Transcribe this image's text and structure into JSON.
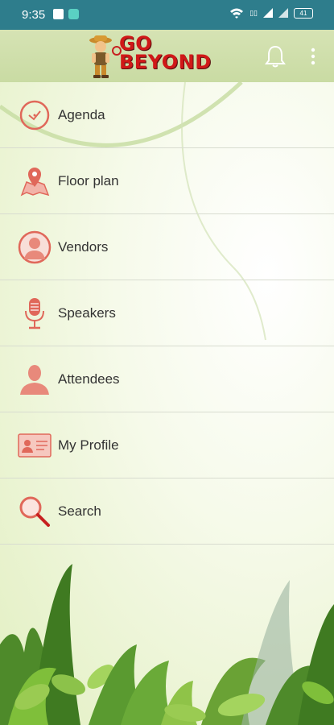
{
  "status_bar": {
    "time": "9:35",
    "battery": "41"
  },
  "app_bar": {
    "logo_line1": "GO",
    "logo_line2": "BEYOND"
  },
  "menu": {
    "items": [
      {
        "label": "Agenda",
        "icon": "clock-icon"
      },
      {
        "label": "Floor plan",
        "icon": "map-pin-icon"
      },
      {
        "label": "Vendors",
        "icon": "person-circle-icon"
      },
      {
        "label": "Speakers",
        "icon": "microphone-icon"
      },
      {
        "label": "Attendees",
        "icon": "person-icon"
      },
      {
        "label": "My Profile",
        "icon": "id-card-icon"
      },
      {
        "label": "Search",
        "icon": "magnifier-icon"
      }
    ]
  },
  "colors": {
    "status_bar": "#2e7d8c",
    "icon_accent": "#e0685a",
    "app_bar": "#cfdfab"
  }
}
